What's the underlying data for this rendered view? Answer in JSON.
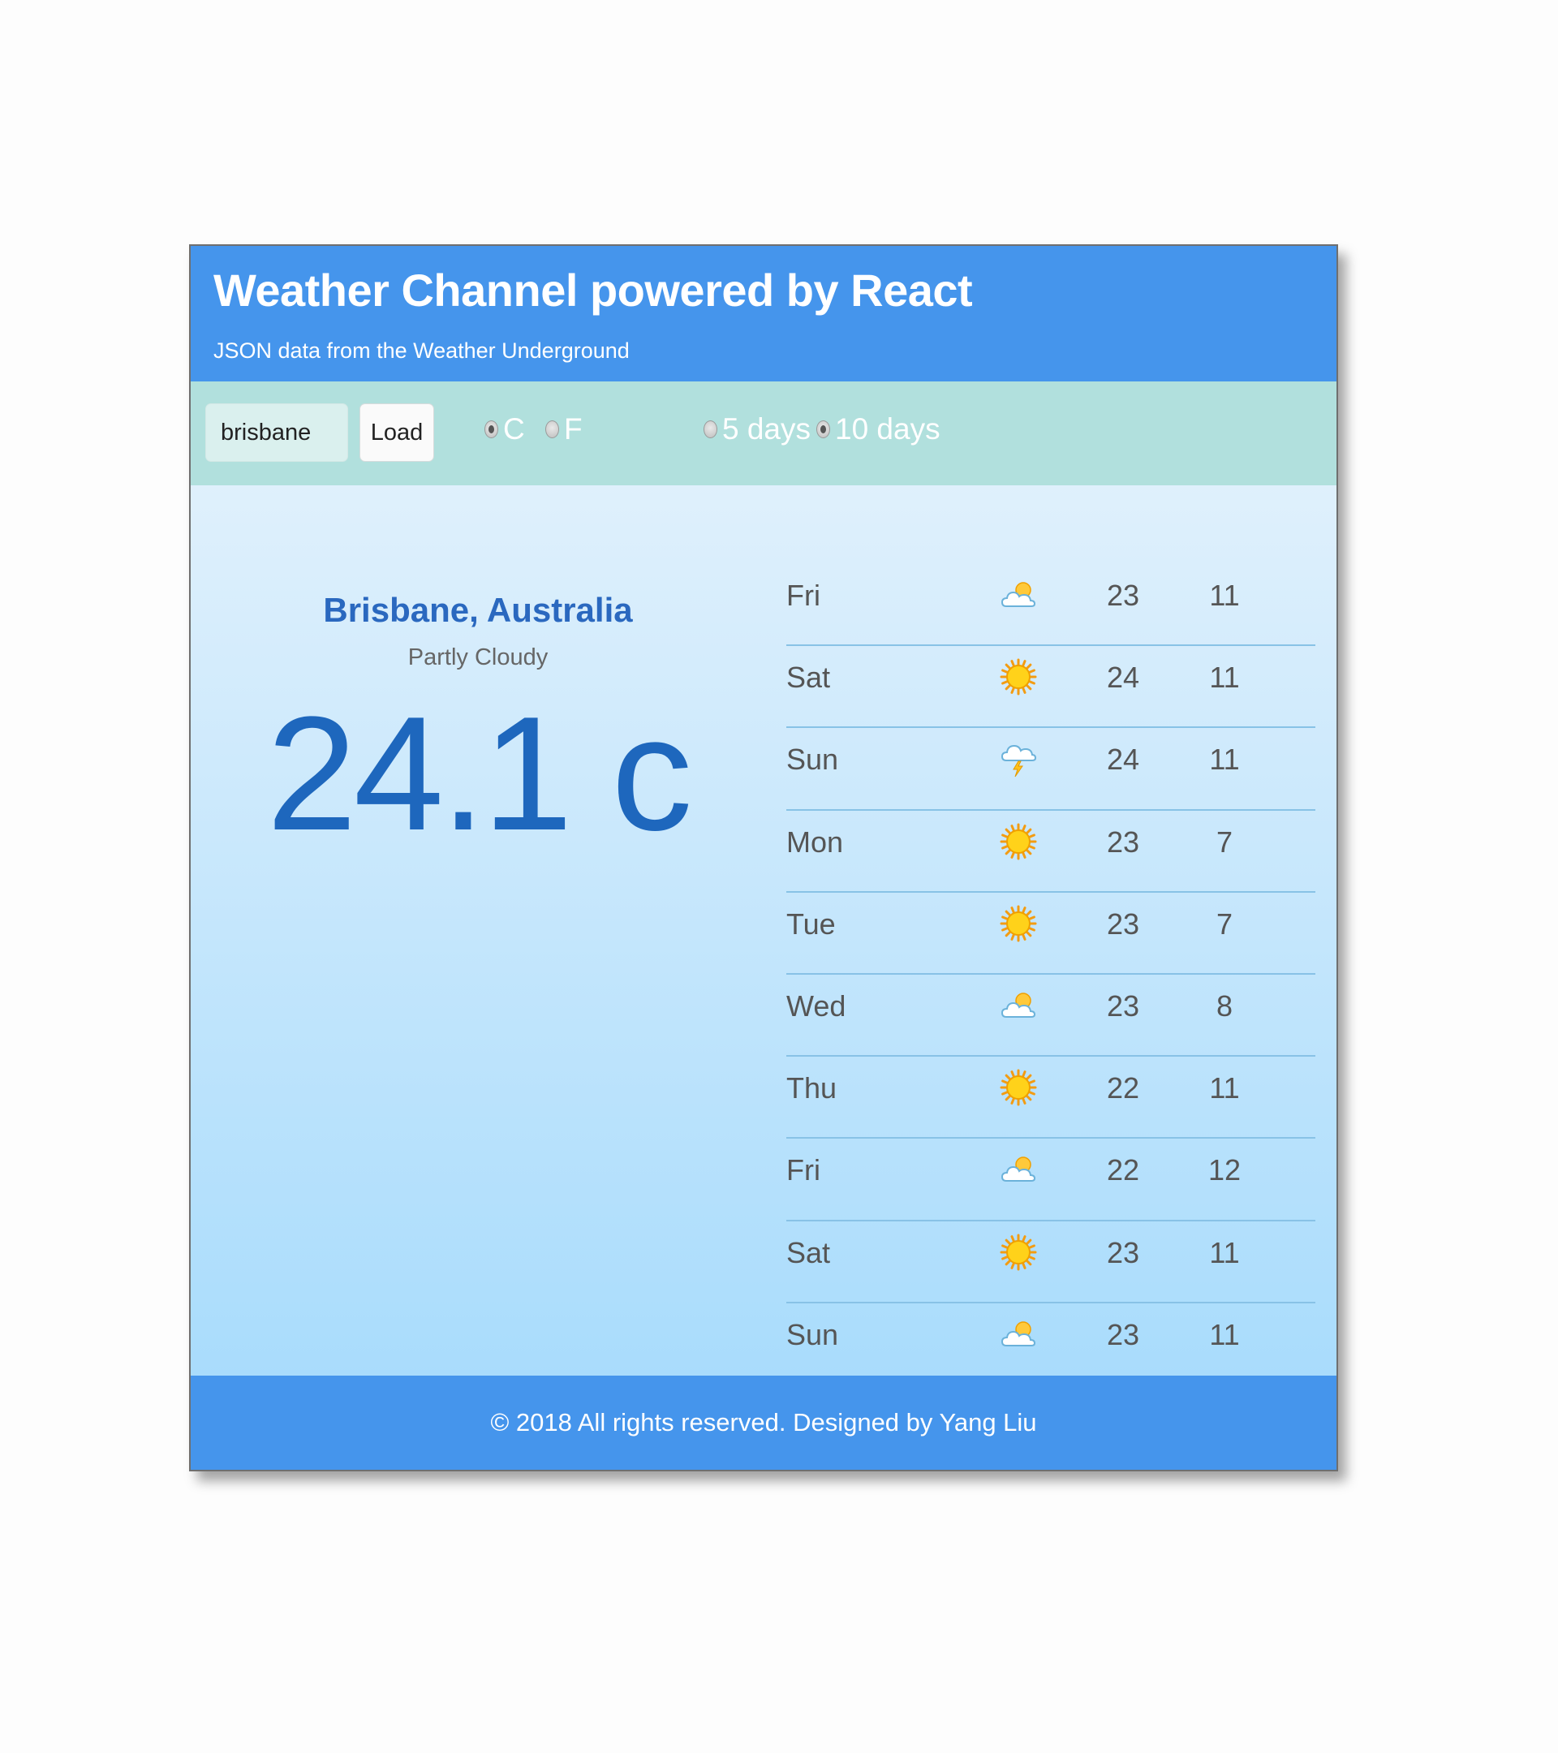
{
  "header": {
    "title": "Weather Channel powered by React",
    "subtitle": "JSON data from the Weather Underground"
  },
  "controls": {
    "search_value": "brisbane",
    "load_label": "Load",
    "units": [
      {
        "label": "C",
        "checked": true
      },
      {
        "label": "F",
        "checked": false
      }
    ],
    "ranges": [
      {
        "label": "5 days",
        "checked": false
      },
      {
        "label": "10 days",
        "checked": true
      }
    ]
  },
  "current": {
    "city": "Brisbane, Australia",
    "condition": "Partly Cloudy",
    "temperature": "24.1 c"
  },
  "forecast": [
    {
      "day": "Fri",
      "icon": "partly-cloudy-icon",
      "high": "23",
      "low": "11"
    },
    {
      "day": "Sat",
      "icon": "sun-icon",
      "high": "24",
      "low": "11"
    },
    {
      "day": "Sun",
      "icon": "thunderstorm-icon",
      "high": "24",
      "low": "11"
    },
    {
      "day": "Mon",
      "icon": "sun-icon",
      "high": "23",
      "low": "7"
    },
    {
      "day": "Tue",
      "icon": "sun-icon",
      "high": "23",
      "low": "7"
    },
    {
      "day": "Wed",
      "icon": "partly-cloudy-icon",
      "high": "23",
      "low": "8"
    },
    {
      "day": "Thu",
      "icon": "sun-icon",
      "high": "22",
      "low": "11"
    },
    {
      "day": "Fri",
      "icon": "partly-cloudy-icon",
      "high": "22",
      "low": "12"
    },
    {
      "day": "Sat",
      "icon": "sun-icon",
      "high": "23",
      "low": "11"
    },
    {
      "day": "Sun",
      "icon": "partly-cloudy-icon",
      "high": "23",
      "low": "11"
    }
  ],
  "footer": {
    "text": "© 2018 All rights reserved. Designed by Yang Liu"
  },
  "colors": {
    "header_bg": "#4595ec",
    "controls_bg": "#b1e0dd",
    "accent_text": "#2a68bf"
  }
}
